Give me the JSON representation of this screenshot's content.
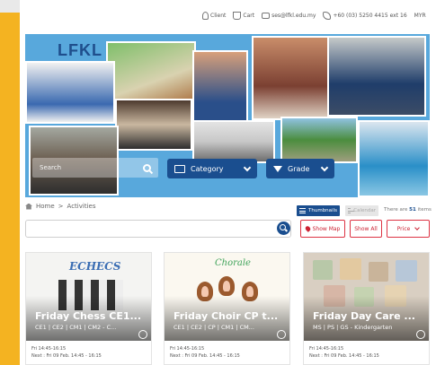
{
  "topbar": {
    "client_label": "Client",
    "cart_label": "Cart",
    "email": "ses@lfkl.edu.my",
    "phone": "+60 (03) 5250 4415 ext 16",
    "currency": "MYR"
  },
  "banner": {
    "logo_text": "LFKL",
    "search_placeholder": "Search",
    "category_label": "Category",
    "grade_label": "Grade"
  },
  "breadcrumb": {
    "home": "Home",
    "separator": ">",
    "current": "Activities"
  },
  "view": {
    "thumbnails_label": "Thumbnails",
    "calendar_label": "Calendar",
    "count_prefix": "There are",
    "count_value": "51",
    "count_suffix": "items"
  },
  "filters": {
    "show_map": "Show Map",
    "show_all": "Show All",
    "price": "Price"
  },
  "cards": [
    {
      "image_text": "ECHECS",
      "title": "Friday Chess CE1...",
      "subtitle": "CE1 | CE2 | CM1 | CM2 - C...",
      "time": "Fri 14:45-16:15",
      "next": "Next : Fri 09 Feb. 14:45 - 16:15"
    },
    {
      "image_text": "Chorale",
      "title": "Friday Choir CP t...",
      "subtitle": "CE1 | CE2 | CP | CM1 | CM...",
      "time": "Fri 14:45-16:15",
      "next": "Next : Fri 09 Feb. 14:45 - 16:15"
    },
    {
      "image_text": "",
      "title": "Friday Day Care ...",
      "subtitle": "MS | PS | GS - Kindergarten",
      "time": "Fri 14:45-16:15",
      "next": "Next : Fri 09 Feb. 14:45 - 16:15"
    }
  ],
  "colors": {
    "brand_blue": "#1a4e8f",
    "accent_red": "#cc2233",
    "side_strip": "#f4b321"
  }
}
